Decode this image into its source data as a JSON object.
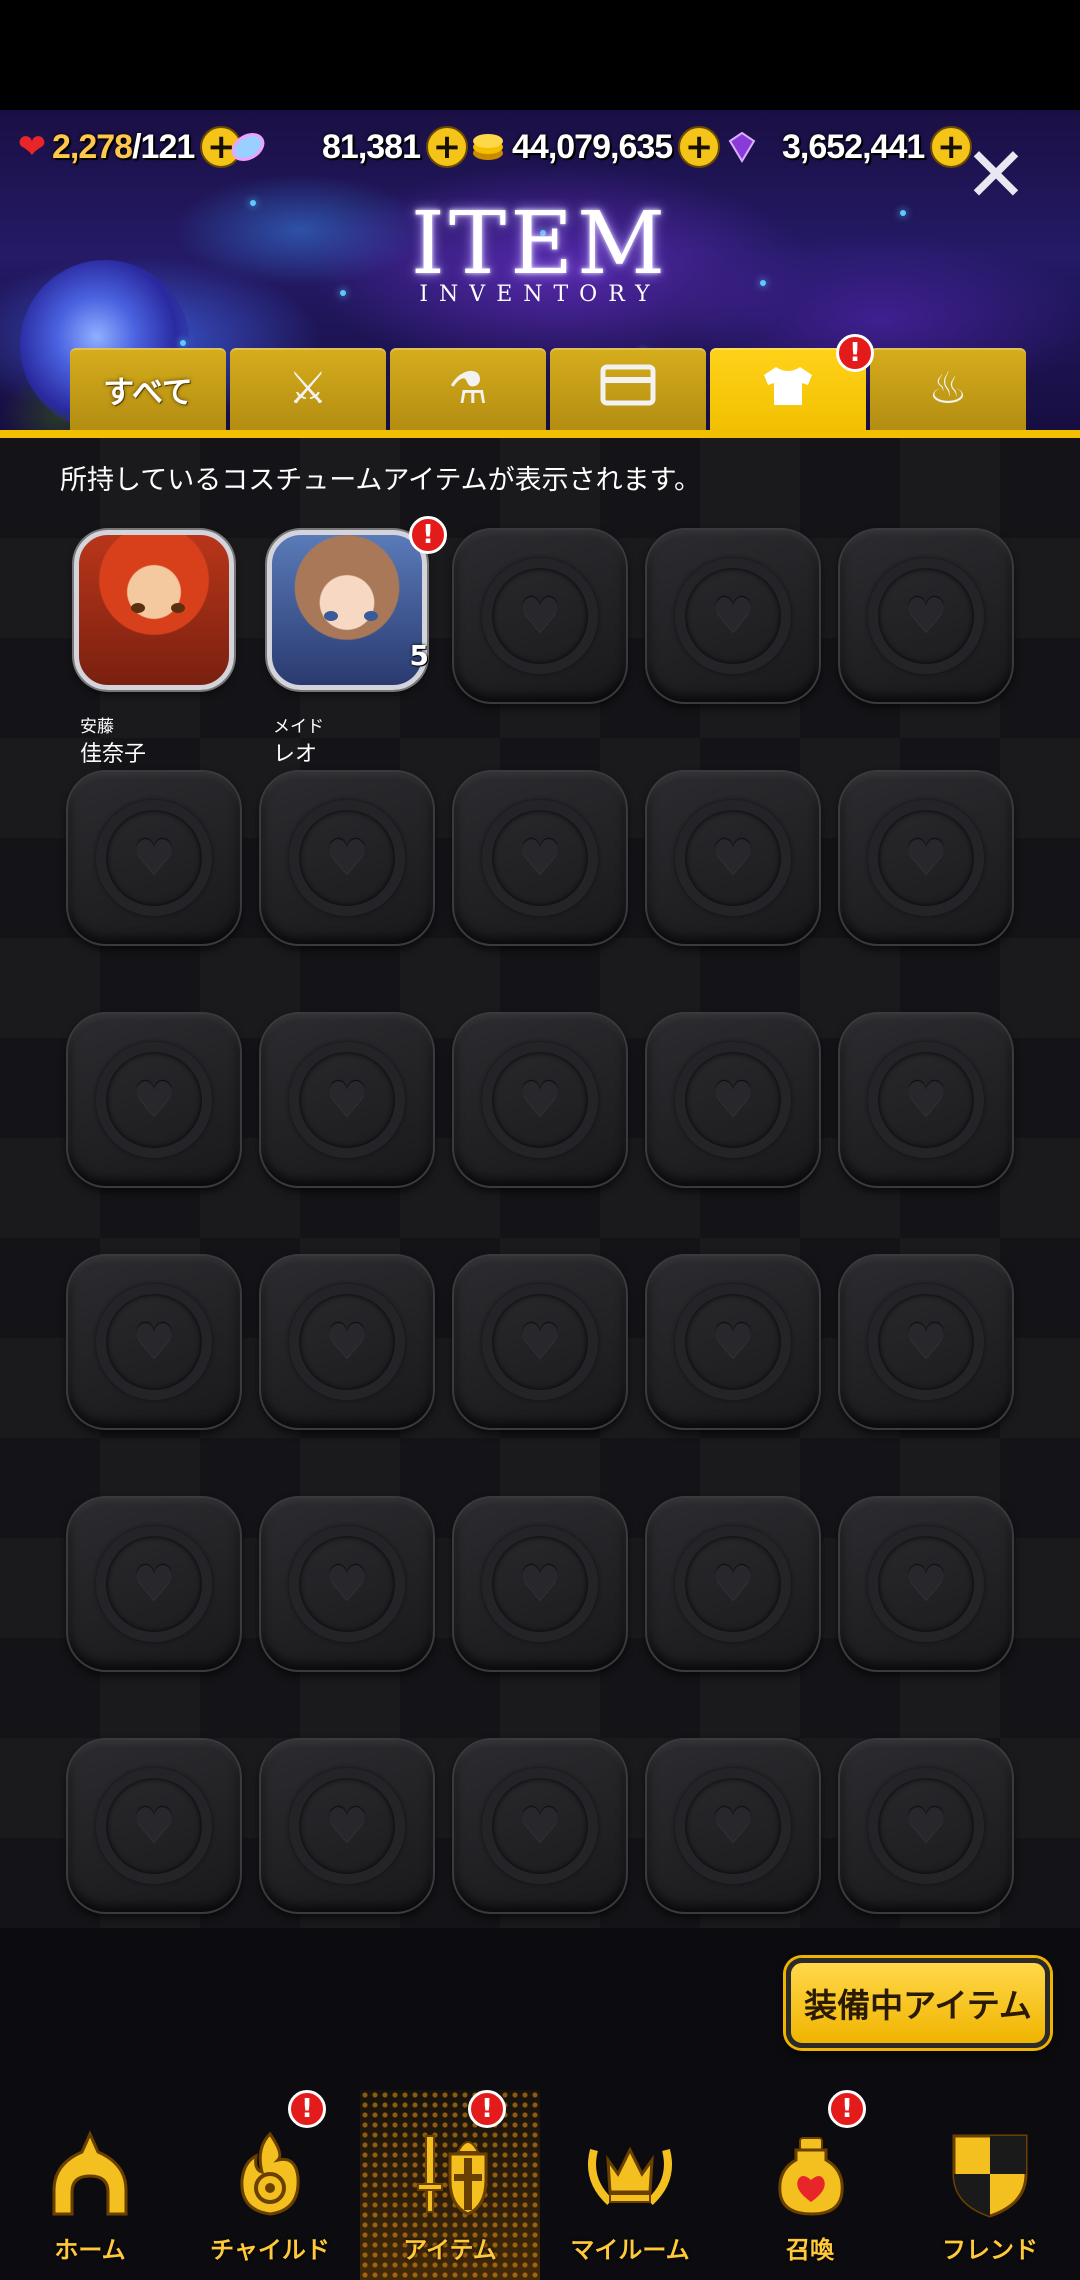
{
  "header": {
    "title": "ITEM",
    "subtitle": "INVENTORY",
    "close_label": "✕",
    "currencies": [
      {
        "name": "stamina",
        "icon": "heart-icon",
        "current": "2,278",
        "max": "/121",
        "plus": "+"
      },
      {
        "name": "crystal",
        "icon": "crystal-icon",
        "value": "81,381",
        "plus": "+"
      },
      {
        "name": "gold",
        "icon": "coin-icon",
        "value": "44,079,635",
        "plus": "+"
      },
      {
        "name": "gem",
        "icon": "gem-icon",
        "value": "3,652,441",
        "plus": "+"
      }
    ]
  },
  "tabs": [
    {
      "label": "すべて",
      "icon": null
    },
    {
      "label": "",
      "icon": "equipment-icon",
      "glyph": "⚔"
    },
    {
      "label": "",
      "icon": "flask-icon",
      "glyph": "⚗"
    },
    {
      "label": "",
      "icon": "card-icon",
      "glyph": "▭"
    },
    {
      "label": "",
      "icon": "costume-icon",
      "glyph": "👕",
      "active": true,
      "alert": "!"
    },
    {
      "label": "",
      "icon": "hot-spring-icon",
      "glyph": "♨"
    }
  ],
  "content": {
    "description": "所持しているコスチュームアイテムが表示されます。",
    "items": [
      {
        "name_small": "安藤",
        "name": "佳奈子",
        "count": "",
        "alert": ""
      },
      {
        "name_small": "メイド",
        "name": "レオ",
        "count": "5",
        "alert": "!"
      }
    ],
    "empty_slot_glyph": "♥",
    "equip_button": "装備中アイテム"
  },
  "nav": [
    {
      "label": "ホーム",
      "icon": "home-icon",
      "alert": ""
    },
    {
      "label": "チャイルド",
      "icon": "flame-icon",
      "alert": "!"
    },
    {
      "label": "アイテム",
      "icon": "sword-shield-icon",
      "alert": "!",
      "active": true
    },
    {
      "label": "マイルーム",
      "icon": "crown-icon",
      "alert": ""
    },
    {
      "label": "召喚",
      "icon": "potion-icon",
      "alert": "!"
    },
    {
      "label": "フレンド",
      "icon": "shield-icon",
      "alert": ""
    }
  ],
  "colors": {
    "accent": "#f2c000",
    "badge": "#e41b1b",
    "nav_label": "#ffc93a",
    "header_bg": "#241a66"
  }
}
